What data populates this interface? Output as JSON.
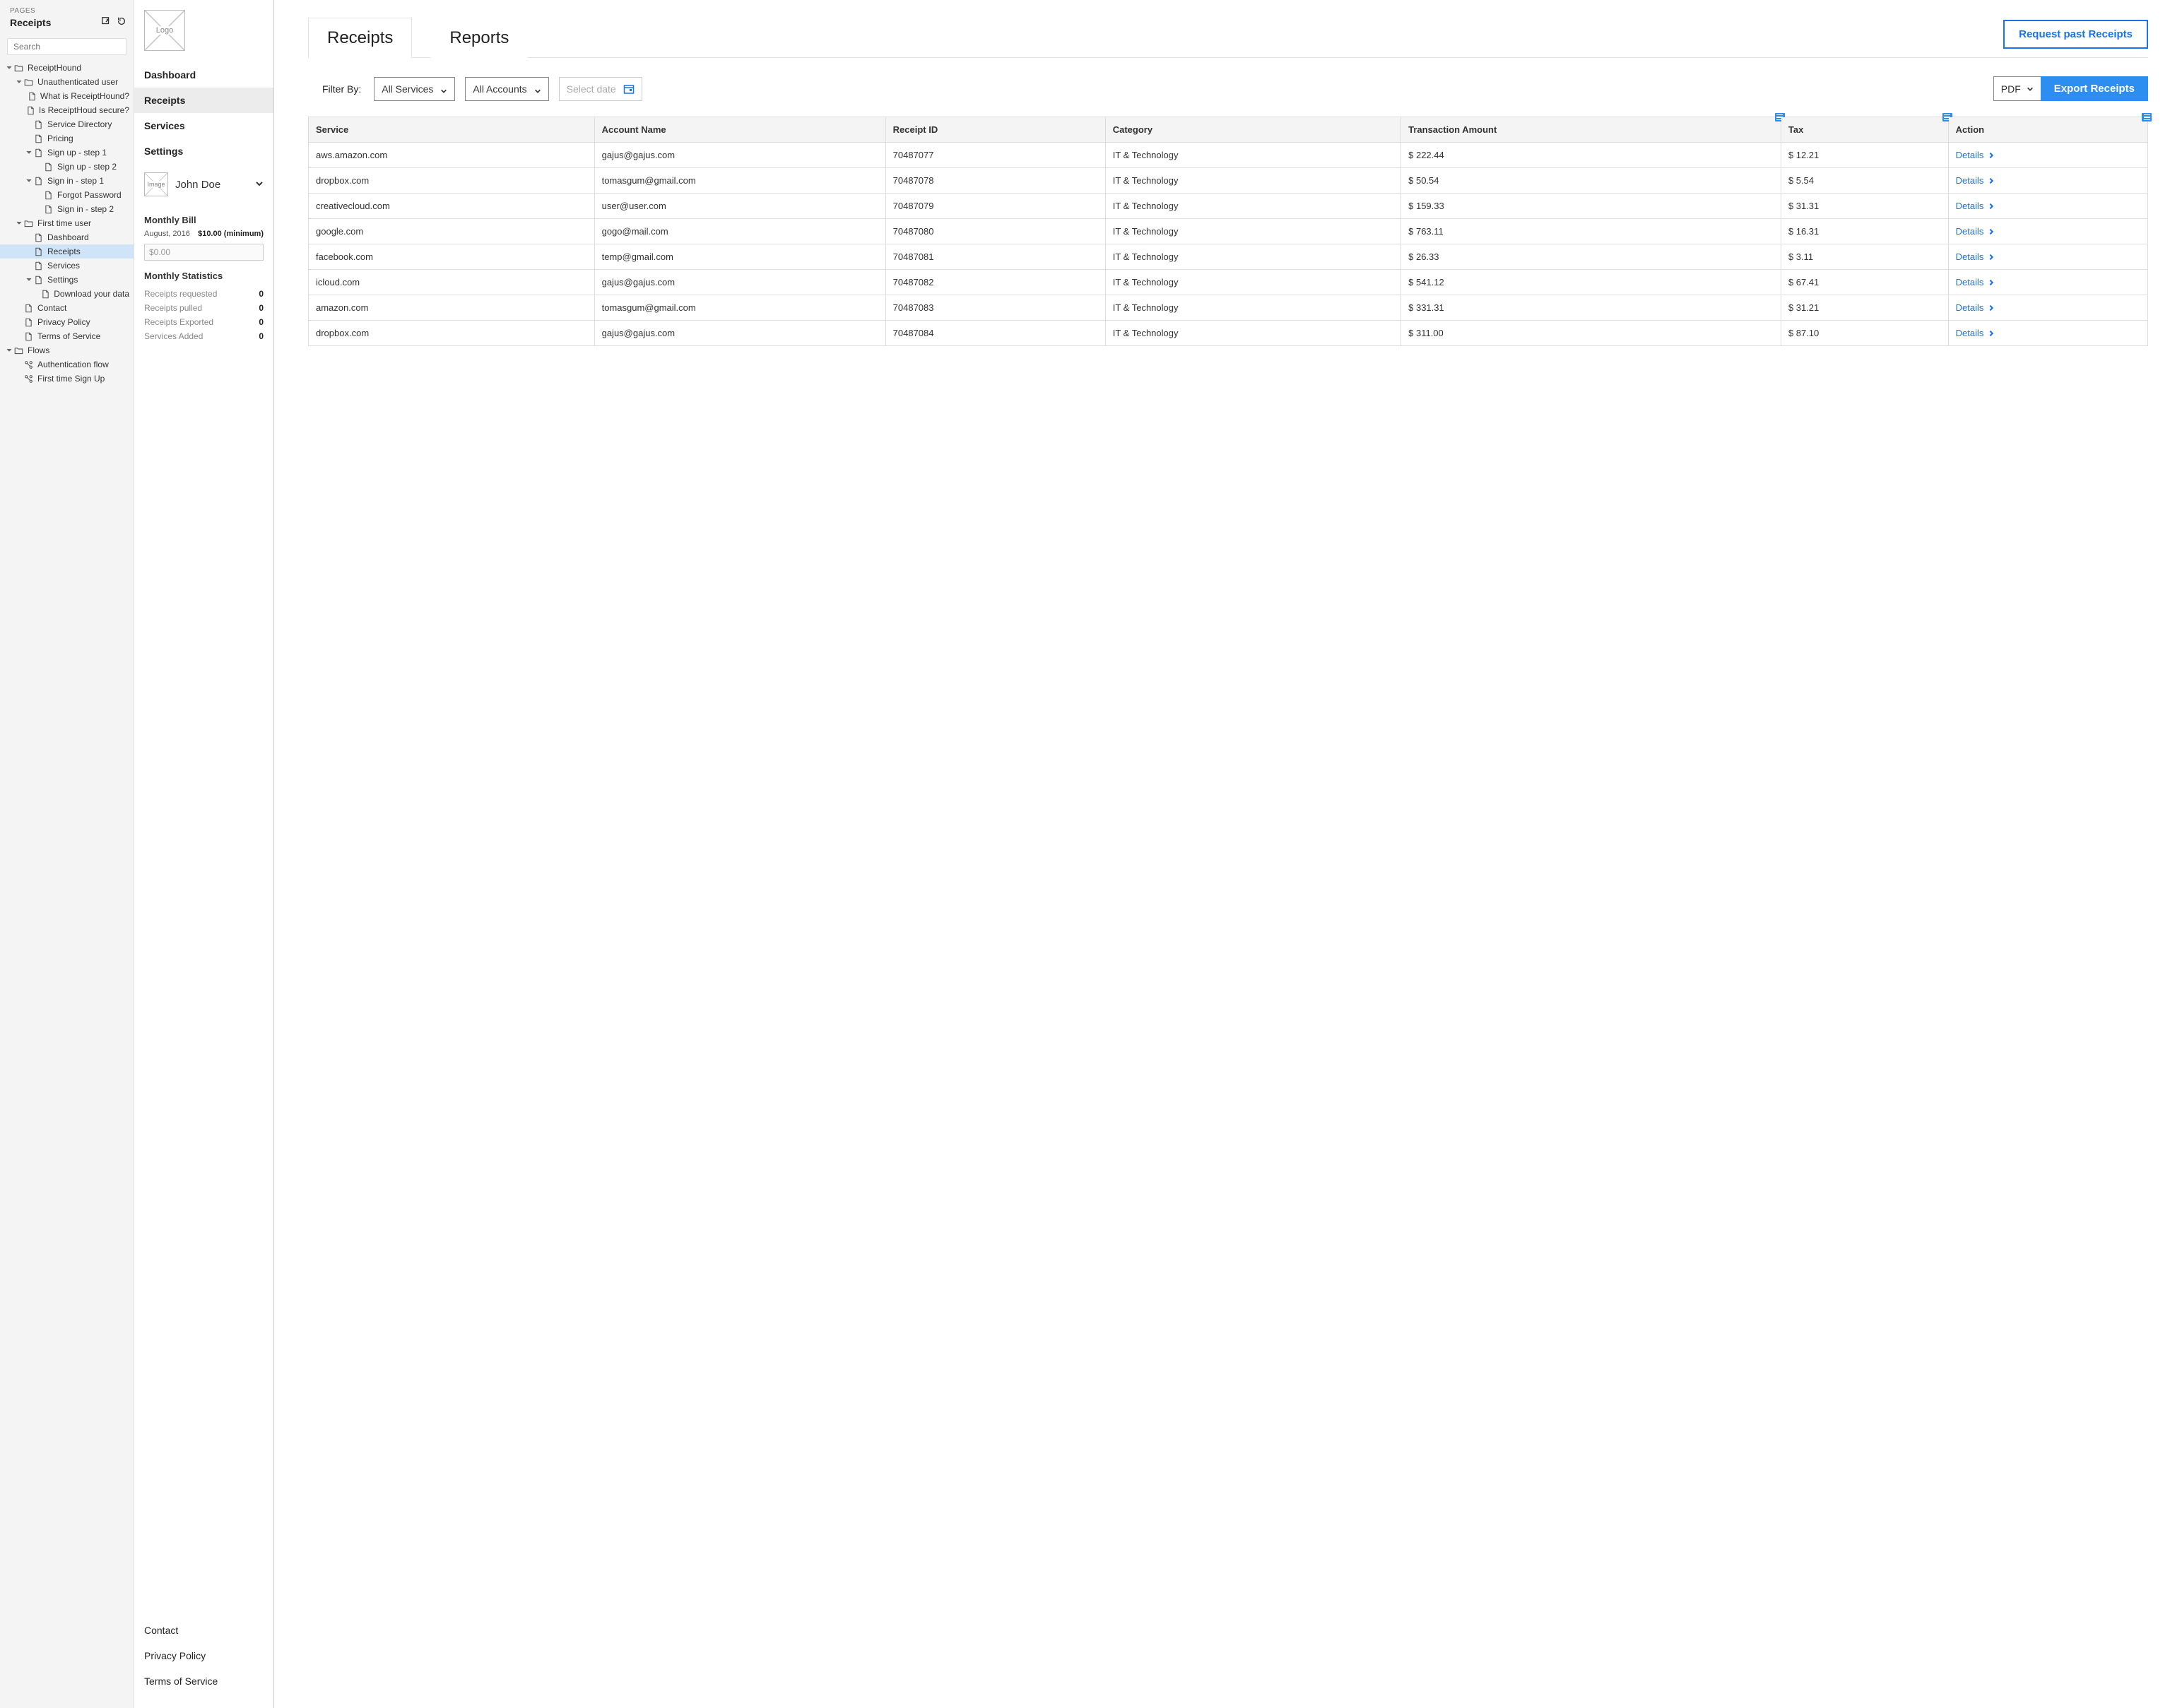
{
  "pagesPanel": {
    "label": "PAGES",
    "title": "Receipts",
    "searchPlaceholder": "Search",
    "tree": [
      {
        "d": 0,
        "caret": true,
        "icon": "folder",
        "label": "ReceiptHound"
      },
      {
        "d": 1,
        "caret": true,
        "icon": "folder",
        "label": "Unauthenticated user"
      },
      {
        "d": 2,
        "caret": false,
        "icon": "page",
        "label": "What is ReceiptHound?"
      },
      {
        "d": 2,
        "caret": false,
        "icon": "page",
        "label": "Is ReceiptHoud secure?"
      },
      {
        "d": 2,
        "caret": false,
        "icon": "page",
        "label": "Service Directory"
      },
      {
        "d": 2,
        "caret": false,
        "icon": "page",
        "label": "Pricing"
      },
      {
        "d": 2,
        "caret": true,
        "icon": "page",
        "label": "Sign up - step 1"
      },
      {
        "d": 3,
        "caret": false,
        "icon": "page",
        "label": "Sign up - step 2"
      },
      {
        "d": 2,
        "caret": true,
        "icon": "page",
        "label": "Sign in - step 1"
      },
      {
        "d": 3,
        "caret": false,
        "icon": "page",
        "label": "Forgot Password"
      },
      {
        "d": 3,
        "caret": false,
        "icon": "page",
        "label": "Sign in - step 2"
      },
      {
        "d": 1,
        "caret": true,
        "icon": "folder",
        "label": "First time user"
      },
      {
        "d": 2,
        "caret": false,
        "icon": "page",
        "label": "Dashboard"
      },
      {
        "d": 2,
        "caret": false,
        "icon": "page",
        "label": "Receipts",
        "selected": true
      },
      {
        "d": 2,
        "caret": false,
        "icon": "page",
        "label": "Services"
      },
      {
        "d": 2,
        "caret": true,
        "icon": "page",
        "label": "Settings"
      },
      {
        "d": 3,
        "caret": false,
        "icon": "page",
        "label": "Download your data"
      },
      {
        "d": 1,
        "caret": false,
        "icon": "page",
        "label": "Contact"
      },
      {
        "d": 1,
        "caret": false,
        "icon": "page",
        "label": "Privacy Policy"
      },
      {
        "d": 1,
        "caret": false,
        "icon": "page",
        "label": "Terms of Service"
      },
      {
        "d": 0,
        "caret": true,
        "icon": "folder",
        "label": "Flows"
      },
      {
        "d": 1,
        "caret": false,
        "icon": "flow",
        "label": "Authentication flow"
      },
      {
        "d": 1,
        "caret": false,
        "icon": "flow",
        "label": "First time Sign Up"
      }
    ]
  },
  "sidebar": {
    "logoLabel": "Logo",
    "nav": [
      {
        "label": "Dashboard",
        "active": false
      },
      {
        "label": "Receipts",
        "active": true
      },
      {
        "label": "Services",
        "active": false
      },
      {
        "label": "Settings",
        "active": false
      }
    ],
    "user": {
      "imgLabel": "Image",
      "name": "John Doe"
    },
    "bill": {
      "title": "Monthly Bill",
      "period": "August, 2016",
      "amount": "$10.00 (minimum)",
      "inputValue": "$0.00"
    },
    "stats": {
      "title": "Monthly Statistics",
      "items": [
        {
          "label": "Receipts requested",
          "value": "0"
        },
        {
          "label": "Receipts pulled",
          "value": "0"
        },
        {
          "label": "Receipts Exported",
          "value": "0"
        },
        {
          "label": "Services Added",
          "value": "0"
        }
      ]
    },
    "footer": [
      "Contact",
      "Privacy Policy",
      "Terms of Service"
    ]
  },
  "main": {
    "tabs": [
      {
        "label": "Receipts",
        "active": true
      },
      {
        "label": "Reports",
        "active": false
      }
    ],
    "requestButton": "Request past Receipts",
    "filterLabel": "Filter By:",
    "serviceFilter": "All Services",
    "accountFilter": "All Accounts",
    "datePlaceholder": "Select date",
    "formatSelect": "PDF",
    "exportButton": "Export Receipts",
    "columns": [
      {
        "label": "Service"
      },
      {
        "label": "Account Name"
      },
      {
        "label": "Receipt ID"
      },
      {
        "label": "Category"
      },
      {
        "label": "Transaction Amount",
        "note": true
      },
      {
        "label": "Tax",
        "note": true
      },
      {
        "label": "Action",
        "noteRight": true
      }
    ],
    "detailsLabel": "Details",
    "rows": [
      {
        "service": "aws.amazon.com",
        "account": "gajus@gajus.com",
        "receipt": "70487077",
        "category": "IT & Technology",
        "amount": "$ 222.44",
        "tax": "$ 12.21"
      },
      {
        "service": "dropbox.com",
        "account": "tomasgum@gmail.com",
        "receipt": "70487078",
        "category": "IT & Technology",
        "amount": "$ 50.54",
        "tax": "$ 5.54"
      },
      {
        "service": "creativecloud.com",
        "account": "user@user.com",
        "receipt": "70487079",
        "category": "IT & Technology",
        "amount": "$ 159.33",
        "tax": "$ 31.31"
      },
      {
        "service": "google.com",
        "account": "gogo@mail.com",
        "receipt": "70487080",
        "category": "IT & Technology",
        "amount": "$ 763.11",
        "tax": "$ 16.31"
      },
      {
        "service": "facebook.com",
        "account": "temp@gmail.com",
        "receipt": "70487081",
        "category": "IT & Technology",
        "amount": "$ 26.33",
        "tax": "$ 3.11"
      },
      {
        "service": "icloud.com",
        "account": "gajus@gajus.com",
        "receipt": "70487082",
        "category": "IT & Technology",
        "amount": "$ 541.12",
        "tax": "$ 67.41"
      },
      {
        "service": "amazon.com",
        "account": "tomasgum@gmail.com",
        "receipt": "70487083",
        "category": "IT & Technology",
        "amount": "$ 331.31",
        "tax": "$ 31.21"
      },
      {
        "service": "dropbox.com",
        "account": "gajus@gajus.com",
        "receipt": "70487084",
        "category": "IT & Technology",
        "amount": "$ 311.00",
        "tax": "$ 87.10"
      }
    ]
  }
}
